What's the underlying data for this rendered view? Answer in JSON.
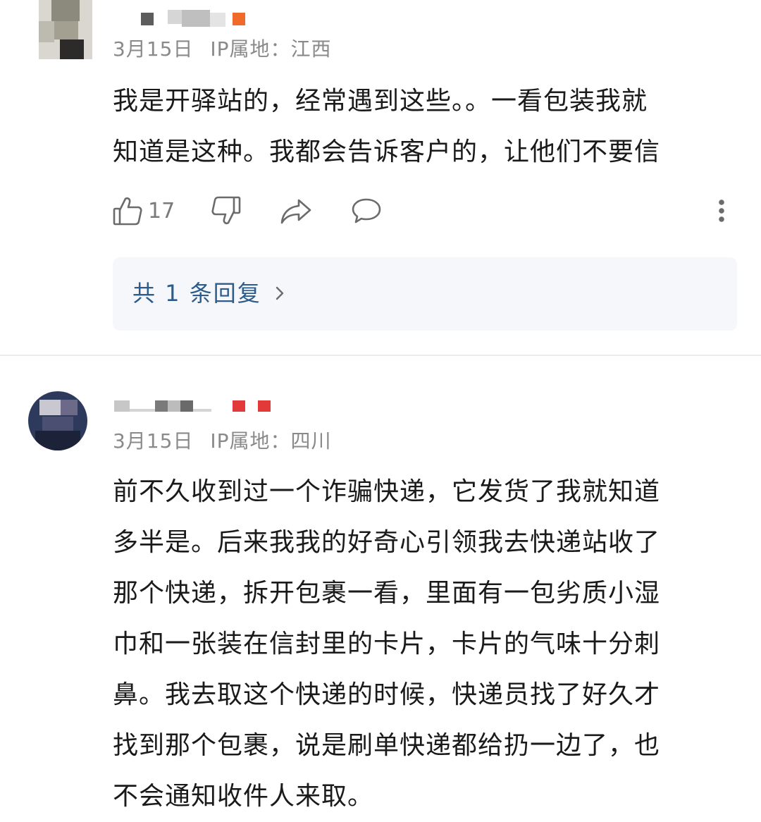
{
  "comments": [
    {
      "date": "3月15日",
      "ip_location": "IP属地：江西",
      "text_lines": [
        "我是开驿站的，经常遇到这些。。一看包装我就",
        "知道是这种。我都会告诉客户的，让他们不要信"
      ],
      "like_count": "17",
      "reply_summary": "共 1 条回复"
    },
    {
      "date": "3月15日",
      "ip_location": "IP属地：四川",
      "text_lines": [
        "前不久收到过一个诈骗快递，它发货了我就知道",
        "多半是。后来我我的好奇心引领我去快递站收了",
        "那个快递，拆开包裹一看，里面有一包劣质小湿",
        "巾和一张装在信封里的卡片，卡片的气味十分刺",
        "鼻。我去取这个快递的时候，快递员找了好久才",
        "找到那个包裹，说是刷单快递都给扔一边了，也",
        "不会通知收件人来取。"
      ]
    }
  ],
  "icons": {
    "like": "thumbs-up-icon",
    "dislike": "thumbs-down-icon",
    "share": "share-icon",
    "comment": "comment-icon",
    "more": "more-vertical-icon",
    "chevron": "chevron-right-icon"
  },
  "colors": {
    "reply_link": "#2d5b8a",
    "meta_text": "#8a8a8a",
    "reply_box_bg": "#f5f7fa"
  }
}
